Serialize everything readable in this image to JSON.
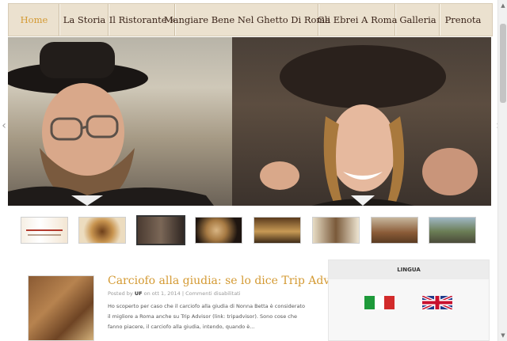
{
  "nav": {
    "items": [
      {
        "label": "Home",
        "active": true
      },
      {
        "label": "La Storia",
        "active": false
      },
      {
        "label": "Il Ristorante »",
        "active": false
      },
      {
        "label": "Mangiare Bene Nel Ghetto Di Roma",
        "active": false
      },
      {
        "label": "Gli Ebrei A Roma",
        "active": false
      },
      {
        "label": "Galleria",
        "active": false
      },
      {
        "label": "Prenota",
        "active": false
      }
    ]
  },
  "slider": {
    "prev_glyph": "‹",
    "next_glyph": "›"
  },
  "thumbnails": [
    {
      "name": "thumb-logo"
    },
    {
      "name": "thumb-dish"
    },
    {
      "name": "thumb-people",
      "active": true
    },
    {
      "name": "thumb-bread"
    },
    {
      "name": "thumb-restaurant"
    },
    {
      "name": "thumb-scroll"
    },
    {
      "name": "thumb-book"
    },
    {
      "name": "thumb-fritters"
    },
    {
      "name": "thumb-street"
    }
  ],
  "post": {
    "title": "Carciofo alla giudia: se lo dice Trip Advisor",
    "meta_prefix": "Posted by",
    "author": "UF",
    "meta_date": "on ott 1, 2014 | Commenti disabilitati",
    "excerpt": "Ho scoperto per caso che il carciofo alla giudia di Nonna Betta è  considerato il migliore a Roma anche su Trip Advisor (link: tripadvisor). Sono cose che fanno piacere, il carciofo alla giudia, intendo, quando è..."
  },
  "sidebar": {
    "title": "LINGUA"
  },
  "colors": {
    "accent": "#d49a33",
    "nav_bg": "#ebe1cf",
    "nav_text": "#3a241a"
  }
}
